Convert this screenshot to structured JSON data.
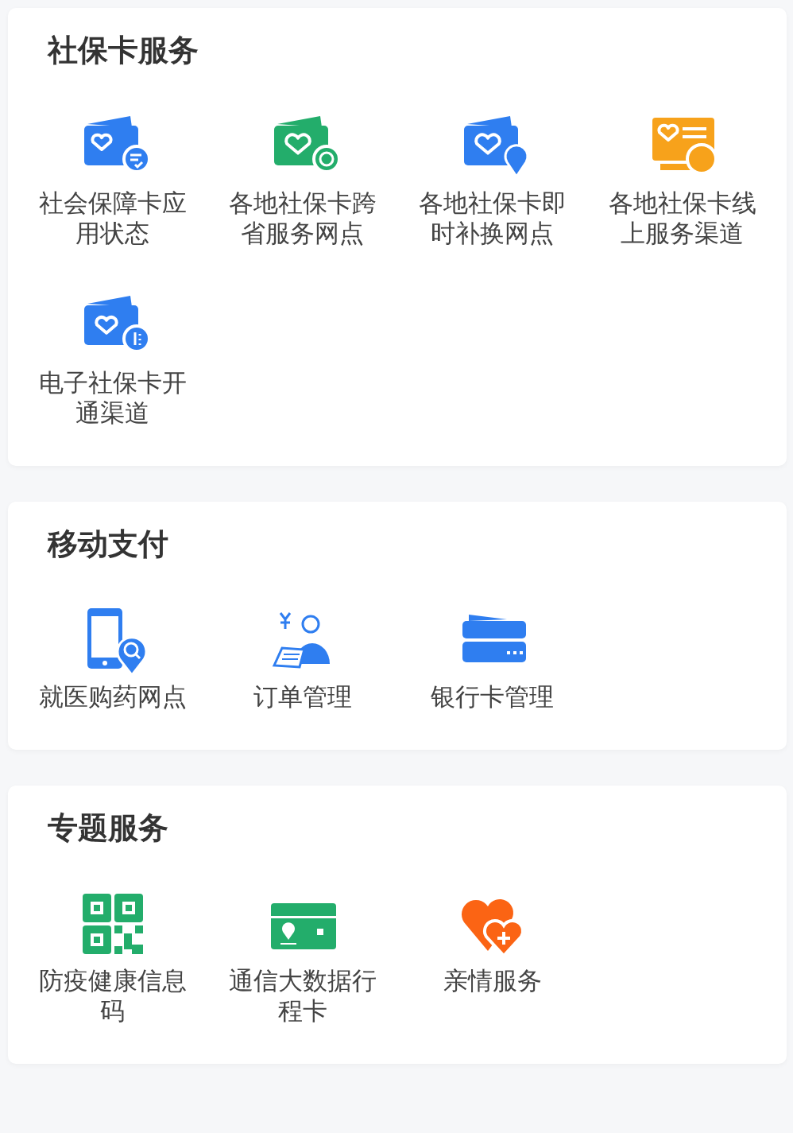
{
  "sections": [
    {
      "title": "社保卡服务",
      "items": [
        {
          "label": "社会保障卡应用状态",
          "kind": "cardcheck"
        },
        {
          "label": "各地社保卡跨省服务网点",
          "kind": "cardglobe"
        },
        {
          "label": "各地社保卡即时补换网点",
          "kind": "cardpin"
        },
        {
          "label": "各地社保卡线上服务渠道",
          "kind": "screen"
        },
        {
          "label": "电子社保卡开通渠道",
          "kind": "cardcoin"
        }
      ]
    },
    {
      "title": "移动支付",
      "items": [
        {
          "label": "就医购药网点",
          "kind": "phone"
        },
        {
          "label": "订单管理",
          "kind": "cashier"
        },
        {
          "label": "银行卡管理",
          "kind": "bankcard"
        }
      ]
    },
    {
      "title": "专题服务",
      "items": [
        {
          "label": "防疫健康信息码",
          "kind": "qr"
        },
        {
          "label": "通信大数据行程卡",
          "kind": "travel"
        },
        {
          "label": "亲情服务",
          "kind": "heart"
        }
      ]
    }
  ]
}
